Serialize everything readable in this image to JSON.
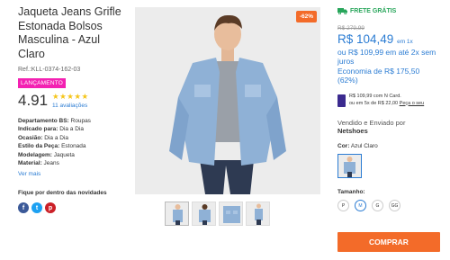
{
  "product": {
    "title": "Jaqueta Jeans Grifle Estonada Bolsos Masculina - Azul Claro",
    "ref": "Ref.:KLL-0374-162-03",
    "badge": "LANÇAMENTO",
    "rating": "4.91",
    "stars": "★★★★★",
    "reviews": "11 avaliações",
    "specs": [
      {
        "label": "Departamento BS:",
        "value": "Roupas"
      },
      {
        "label": "Indicado para:",
        "value": "Dia a Dia"
      },
      {
        "label": "Ocasião:",
        "value": "Dia a Dia"
      },
      {
        "label": "Estilo da Peça:",
        "value": "Estonada"
      },
      {
        "label": "Modelagem:",
        "value": "Jaqueta"
      },
      {
        "label": "Material:",
        "value": "Jeans"
      }
    ],
    "more_link": "Ver mais",
    "inside_label": "Fique por dentro das novidades",
    "social": [
      "f",
      "t",
      "p"
    ]
  },
  "gallery": {
    "discount": "-62%"
  },
  "purchase": {
    "free_shipping": "FRETE GRÁTIS",
    "old_price": "R$ 279,99",
    "price": "R$ 104,49",
    "price_suffix": "em 1x",
    "installment": "ou R$ 109,99 em até 2x sem juros",
    "economy": "Economia de R$ 175,50 (62%)",
    "card_line1": "R$ 109,99 com N Card.",
    "card_line2": "ou em 5x de R$ 22,00",
    "card_link": "Peça o seu",
    "seller_prefix": "Vendido e Enviado por",
    "seller": "Netshoes",
    "color_label": "Cor:",
    "color_value": "Azul Claro",
    "size_label": "Tamanho:",
    "sizes": [
      "P",
      "M",
      "G",
      "GG"
    ],
    "selected_size": "M",
    "buy_label": "COMPRAR"
  },
  "colors": {
    "accent_blue": "#2b7cd3",
    "orange": "#f36b29",
    "pink_badge": "#f321b2",
    "green": "#27a55a"
  }
}
